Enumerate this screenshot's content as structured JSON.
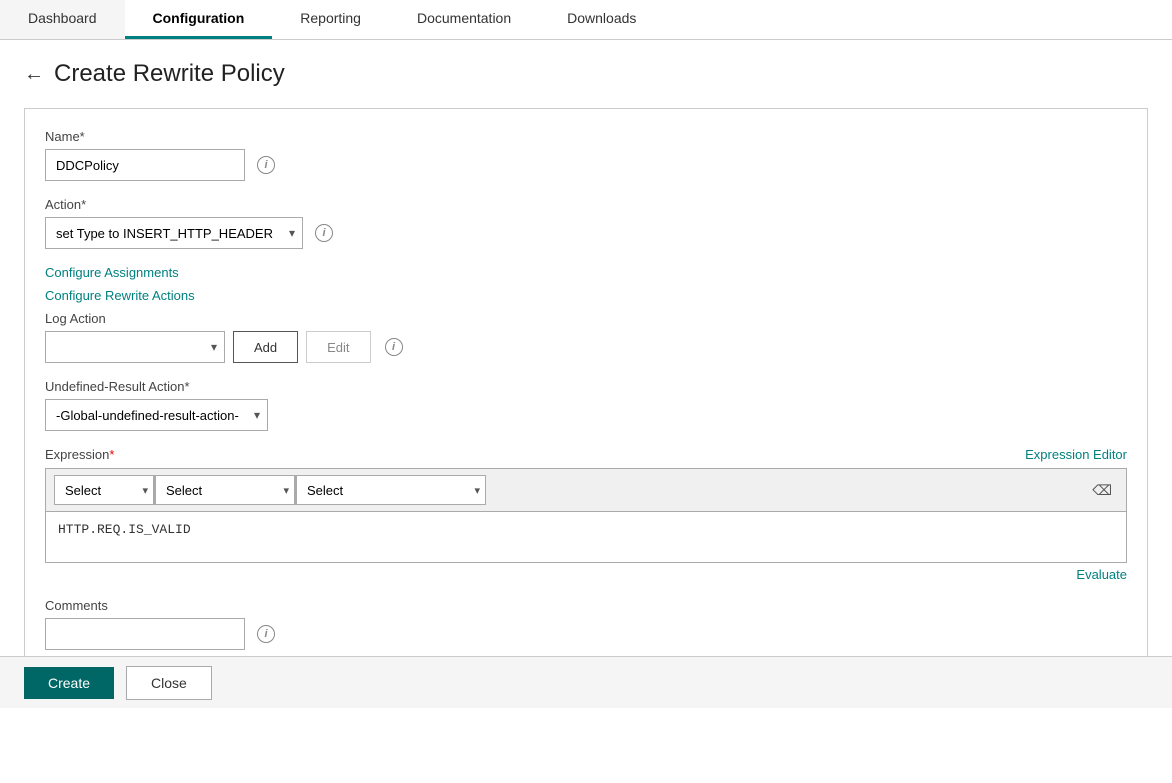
{
  "nav": {
    "tabs": [
      {
        "label": "Dashboard",
        "active": false
      },
      {
        "label": "Configuration",
        "active": true
      },
      {
        "label": "Reporting",
        "active": false
      },
      {
        "label": "Documentation",
        "active": false
      },
      {
        "label": "Downloads",
        "active": false
      }
    ]
  },
  "page": {
    "title": "Create Rewrite Policy",
    "back_label": "←"
  },
  "form": {
    "name_label": "Name*",
    "name_value": "DDCPolicy",
    "name_placeholder": "",
    "action_label": "Action*",
    "action_value": "set Type to INSERT_HTTP_HEADER",
    "action_options": [
      "set Type to INSERT_HTTP_HEADER"
    ],
    "configure_assignments_link": "Configure Assignments",
    "configure_rewrite_actions_link": "Configure Rewrite Actions",
    "log_action_label": "Log Action",
    "log_action_value": "",
    "add_button": "Add",
    "edit_button": "Edit",
    "undefined_result_label": "Undefined-Result Action*",
    "undefined_result_value": "-Global-undefined-result-action-",
    "expression_label": "Expression",
    "expression_required": "*",
    "expression_editor_link": "Expression Editor",
    "expression_select1": "Select",
    "expression_select2": "Select",
    "expression_select3": "Select",
    "expression_text": "HTTP.REQ.IS_VALID",
    "evaluate_link": "Evaluate",
    "comments_label": "Comments",
    "comments_value": "",
    "comments_placeholder": ""
  },
  "footer": {
    "create_button": "Create",
    "close_button": "Close"
  },
  "icons": {
    "info": "i",
    "backspace": "⌫",
    "chevron_down": "▾"
  }
}
